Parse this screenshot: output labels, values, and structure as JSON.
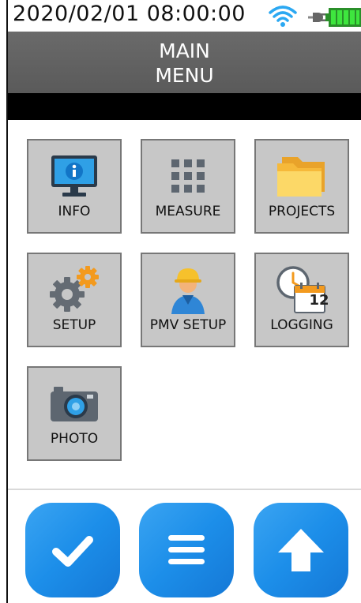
{
  "status": {
    "datetime": "2020/02/01 08:00:00",
    "wifi_icon": "wifi-icon",
    "power_icon": "plug-icon",
    "battery_icon": "battery-icon",
    "battery_color": "#2bcf2b"
  },
  "title": {
    "line1": "MAIN",
    "line2": "MENU",
    "bg": "#5f5f5f"
  },
  "menu": {
    "items": [
      {
        "label": "INFO",
        "icon": "info-monitor-icon"
      },
      {
        "label": "MEASURE",
        "icon": "grid-icon"
      },
      {
        "label": "PROJECTS",
        "icon": "folder-icon"
      },
      {
        "label": "SETUP",
        "icon": "gears-icon"
      },
      {
        "label": "PMV SETUP",
        "icon": "worker-icon"
      },
      {
        "label": "LOGGING",
        "icon": "clock-calendar-icon"
      },
      {
        "label": "PHOTO",
        "icon": "camera-icon"
      }
    ],
    "calendar_day": "12"
  },
  "bottom": {
    "confirm_icon": "checkmark-icon",
    "menu_icon": "hamburger-icon",
    "up_icon": "up-arrow-icon",
    "accent": "#1e8fea"
  }
}
